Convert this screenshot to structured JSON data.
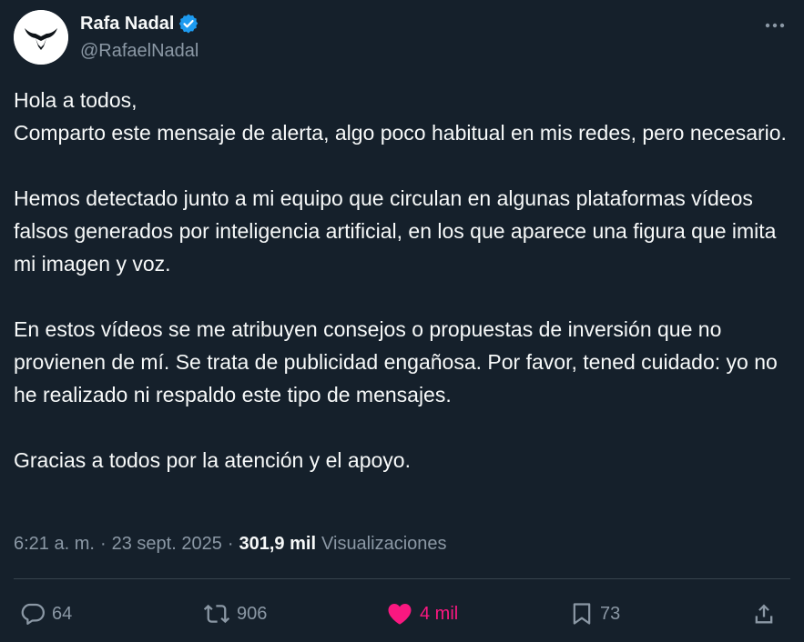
{
  "author": {
    "display_name": "Rafa Nadal",
    "handle": "@RafaelNadal",
    "verified": true,
    "avatar_icon": "rafa-bull-logo-icon"
  },
  "tweet": {
    "paragraphs": [
      [
        "Hola a todos,",
        "Comparto este mensaje de alerta, algo poco habitual en mis redes, pero necesario."
      ],
      [
        "Hemos detectado junto a mi equipo que circulan en algunas plataformas vídeos falsos generados por inteligencia artificial, en los que aparece una figura que imita mi imagen y voz."
      ],
      [
        "En estos vídeos se me atribuyen consejos o propuestas de inversión que no provienen de mí. Se trata de publicidad engañosa. Por favor, tened cuidado: yo no he realizado ni respaldo este tipo de mensajes."
      ],
      [
        "Gracias a todos por la atención y el apoyo."
      ]
    ]
  },
  "meta": {
    "time": "6:21 a. m.",
    "separator": "·",
    "date": "23 sept. 2025",
    "views_count": "301,9 mil",
    "views_label": "Visualizaciones"
  },
  "actions": {
    "replies": "64",
    "reposts": "906",
    "likes": "4 mil",
    "bookmarks": "73"
  },
  "colors": {
    "background": "#15202b",
    "text": "#f7f9f9",
    "secondary_text": "#8b98a5",
    "divider": "#38444d",
    "verified_badge": "#1d9bf0",
    "like_active": "#f91880"
  },
  "icons": {
    "more": "more-horizontal-icon",
    "verified": "verified-badge-icon",
    "reply": "reply-bubble-icon",
    "repost": "repost-arrows-icon",
    "like": "heart-filled-icon",
    "bookmark": "bookmark-icon",
    "share": "share-upload-icon"
  }
}
